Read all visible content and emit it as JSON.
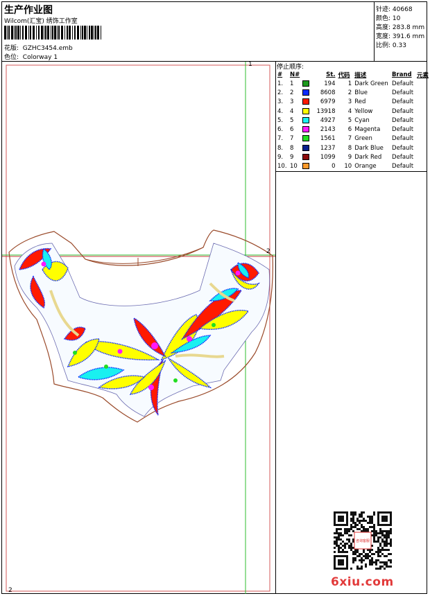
{
  "header": {
    "title": "生产作业图",
    "studio": "Wilcom(汇宝) 绣饰工作室",
    "pattern_label": "花版:",
    "pattern_value": "GZHC3454.emb",
    "colorway_label": "色位:",
    "colorway_value": "Colorway 1"
  },
  "stats": [
    {
      "label": "针迹:",
      "value": "40668"
    },
    {
      "label": "颜色:",
      "value": "10"
    },
    {
      "label": "高度:",
      "value": "283.8 mm"
    },
    {
      "label": "宽度:",
      "value": "391.6 mm"
    },
    {
      "label": "比例:",
      "value": "0.33"
    }
  ],
  "stop_sequence": {
    "title": "停止顺序:",
    "headers": [
      "#",
      "N#",
      "St.",
      "代码",
      "描述",
      "Brand",
      "元素"
    ],
    "rows": [
      {
        "n": "1.",
        "nn": "1",
        "color": "#1e9a1e",
        "st": "194",
        "code": "1",
        "desc": "Dark Green",
        "brand": "Default"
      },
      {
        "n": "2.",
        "nn": "2",
        "color": "#0b2bff",
        "st": "8608",
        "code": "2",
        "desc": "Blue",
        "brand": "Default"
      },
      {
        "n": "3.",
        "nn": "3",
        "color": "#ff1a00",
        "st": "6979",
        "code": "3",
        "desc": "Red",
        "brand": "Default"
      },
      {
        "n": "4.",
        "nn": "4",
        "color": "#ffff00",
        "st": "13918",
        "code": "4",
        "desc": "Yellow",
        "brand": "Default"
      },
      {
        "n": "5.",
        "nn": "5",
        "color": "#19f0f0",
        "st": "4927",
        "code": "5",
        "desc": "Cyan",
        "brand": "Default"
      },
      {
        "n": "6.",
        "nn": "6",
        "color": "#ff19ff",
        "st": "2143",
        "code": "6",
        "desc": "Magenta",
        "brand": "Default"
      },
      {
        "n": "7.",
        "nn": "7",
        "color": "#22dd22",
        "st": "1561",
        "code": "7",
        "desc": "Green",
        "brand": "Default"
      },
      {
        "n": "8.",
        "nn": "8",
        "color": "#0a1e8c",
        "st": "1237",
        "code": "8",
        "desc": "Dark Blue",
        "brand": "Default"
      },
      {
        "n": "9.",
        "nn": "9",
        "color": "#8c0a0a",
        "st": "1099",
        "code": "9",
        "desc": "Dark Red",
        "brand": "Default"
      },
      {
        "n": "10.",
        "nn": "10",
        "color": "#ff9a2a",
        "st": "0",
        "code": "10",
        "desc": "Orange",
        "brand": "Default"
      }
    ]
  },
  "canvas": {
    "corner_top_right": "1",
    "hoop_mark_right": "2",
    "corner_bottom_left": "2"
  },
  "watermark": "6xiu.com",
  "qr_badge": "咨询客服"
}
